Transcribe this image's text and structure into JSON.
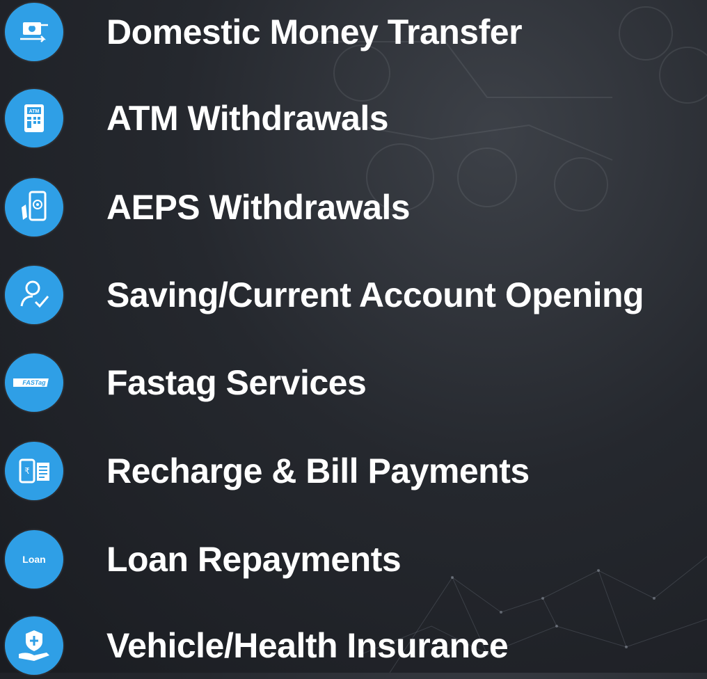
{
  "services": [
    {
      "label": "Domestic Money Transfer",
      "icon": "money-transfer-icon"
    },
    {
      "label": "ATM Withdrawals",
      "icon": "atm-icon"
    },
    {
      "label": "AEPS Withdrawals",
      "icon": "fingerprint-phone-icon"
    },
    {
      "label": "Saving/Current Account Opening",
      "icon": "user-check-icon"
    },
    {
      "label": "Fastag Services",
      "icon": "fastag-icon"
    },
    {
      "label": "Recharge & Bill Payments",
      "icon": "phone-bill-icon"
    },
    {
      "label": "Loan Repayments",
      "icon": "loan-icon"
    },
    {
      "label": "Vehicle/Health Insurance",
      "icon": "insurance-shield-hand-icon"
    }
  ],
  "icon_text": {
    "atm": "ATM",
    "fastag": "FASTag",
    "loan": "Loan"
  },
  "colors": {
    "icon_bg": "#2f9fe6",
    "text": "#ffffff",
    "background": "#25282e"
  }
}
